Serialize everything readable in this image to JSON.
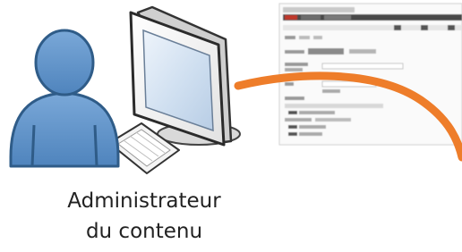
{
  "caption": {
    "line1": "Administrateur",
    "line2": "du contenu"
  },
  "colors": {
    "person_body": "#5b8fc6",
    "person_outline": "#3e6f9f",
    "monitor_frame": "#f3f3f3",
    "monitor_screen": "#dfe9f5",
    "arrow": "#ee7d2a",
    "thumbnail_header": "#4a4a4a",
    "thumbnail_accent": "#c0392b"
  },
  "icons": {
    "person": "user-icon",
    "computer": "desktop-computer-icon",
    "keyboard": "keyboard-icon",
    "arrow": "curved-arrow"
  }
}
